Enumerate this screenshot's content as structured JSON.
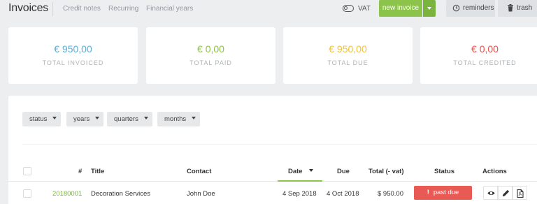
{
  "header": {
    "title": "Invoices",
    "subnav": [
      "Credit notes",
      "Recurring",
      "Financial years"
    ],
    "vat_label": "VAT",
    "new_invoice_label": "new invoice",
    "reminders_label": "reminders",
    "trash_label": "trash"
  },
  "colors": {
    "invoiced": "#5aaed5",
    "paid": "#8cc34b",
    "due": "#f0c33c",
    "credited": "#e8504b",
    "accent": "#8cc34b",
    "danger": "#ea5a55"
  },
  "stats": [
    {
      "amount": "€ 950,00",
      "label": "TOTAL INVOICED"
    },
    {
      "amount": "€ 0,00",
      "label": "TOTAL PAID"
    },
    {
      "amount": "€ 950,00",
      "label": "TOTAL DUE"
    },
    {
      "amount": "€ 0,00",
      "label": "TOTAL CREDITED"
    }
  ],
  "filters": [
    "status",
    "years",
    "quarters",
    "months"
  ],
  "table": {
    "columns": {
      "number": "#",
      "title": "Title",
      "contact": "Contact",
      "date": "Date",
      "due": "Due",
      "total": "Total (- vat)",
      "status": "Status",
      "actions": "Actions"
    },
    "sort_column": "date",
    "rows": [
      {
        "number": "20180001",
        "title": "Decoration Services",
        "contact": "John Doe",
        "date": "4 Sep 2018",
        "due": "4 Oct 2018",
        "total": "$ 950.00",
        "status": "past due",
        "status_icon": "exclamation-icon",
        "actions": [
          "eye-icon",
          "pencil-icon",
          "pdf-icon"
        ]
      }
    ]
  }
}
